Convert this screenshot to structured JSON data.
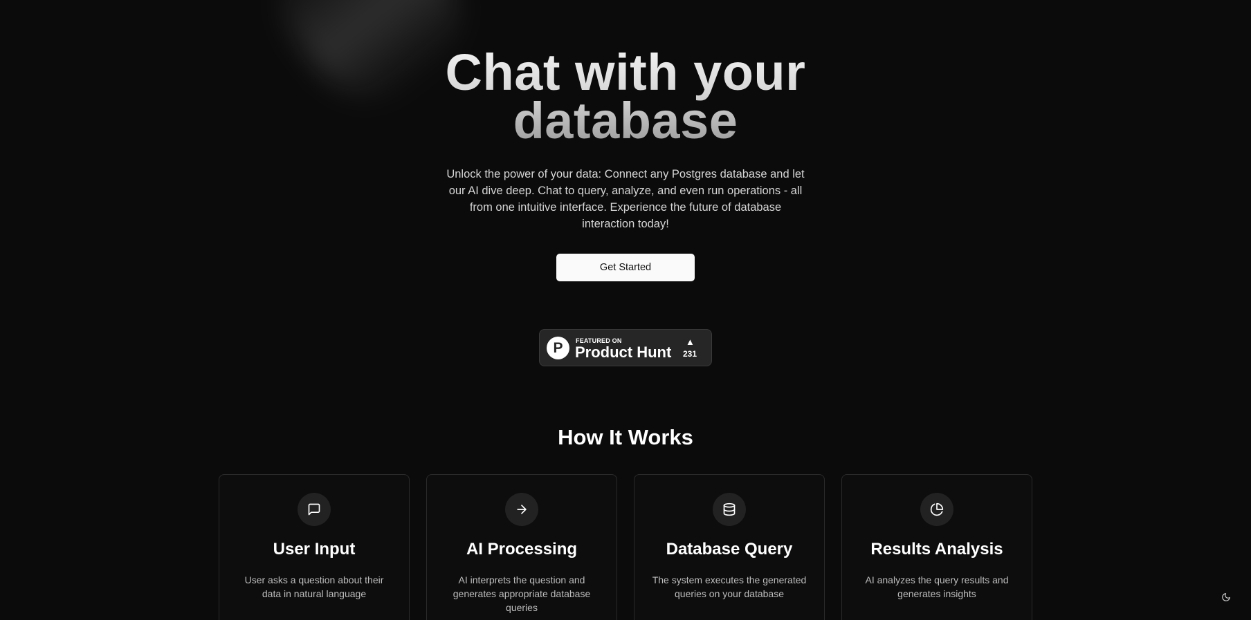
{
  "hero": {
    "title": "Chat with your database",
    "subtitle": "Unlock the power of your data: Connect any Postgres database and let our AI dive deep. Chat to query, analyze, and even run operations - all from one intuitive interface. Experience the future of database interaction today!",
    "cta_label": "Get Started"
  },
  "product_hunt": {
    "logo_letter": "P",
    "featured_text": "FEATURED ON",
    "name": "Product Hunt",
    "upvote_arrow": "▲",
    "upvotes": "231"
  },
  "how_it_works": {
    "title": "How It Works",
    "steps": [
      {
        "icon": "message-square-icon",
        "title": "User Input",
        "description": "User asks a question about their data in natural language"
      },
      {
        "icon": "arrow-right-icon",
        "title": "AI Processing",
        "description": "AI interprets the question and generates appropriate database queries"
      },
      {
        "icon": "database-icon",
        "title": "Database Query",
        "description": "The system executes the generated queries on your database"
      },
      {
        "icon": "pie-chart-icon",
        "title": "Results Analysis",
        "description": "AI analyzes the query results and generates insights"
      }
    ]
  },
  "theme_toggle": {
    "icon": "moon-icon"
  },
  "colors": {
    "background": "#0b0b0b",
    "card_border": "#2a2a2a",
    "button_bg": "#fafafa",
    "badge_bg": "#262626"
  }
}
